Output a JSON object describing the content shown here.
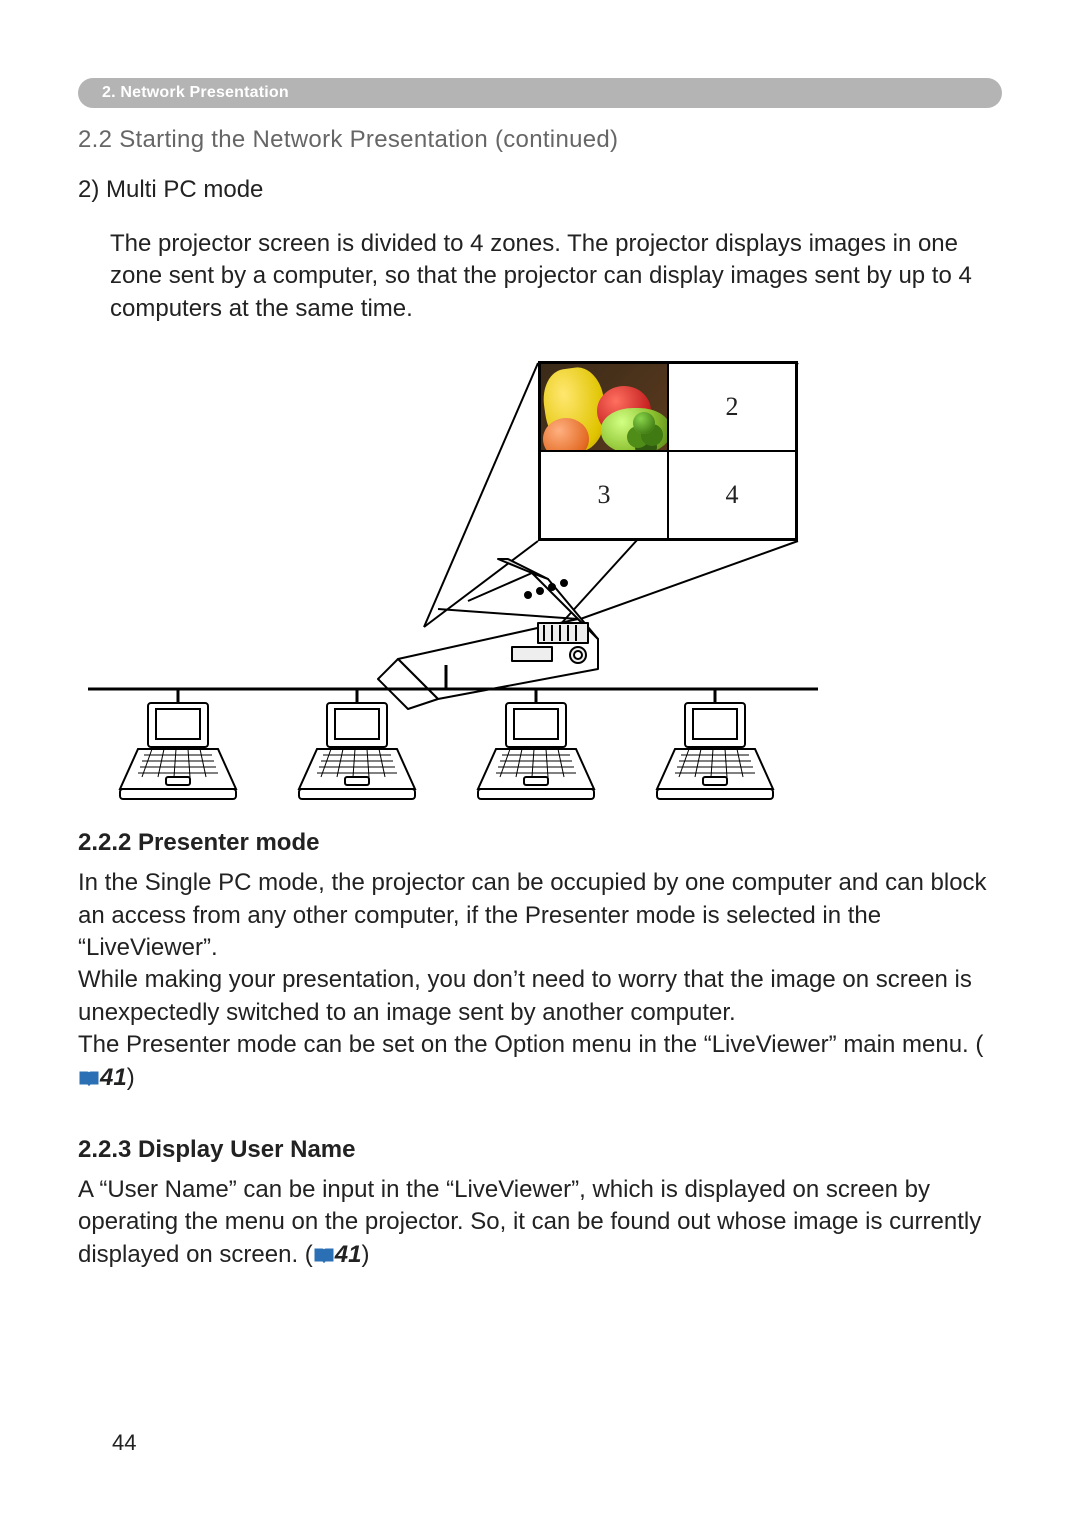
{
  "chapter_tab": "2. Network Presentation",
  "section_title": "2.2 Starting the Network Presentation (continued)",
  "multi_pc": {
    "heading": "2) Multi PC mode",
    "body": "The projector screen is divided to 4 zones. The projector displays images in one zone sent by a computer, so that the projector can display images sent by up to 4 computers at the same time."
  },
  "zones": {
    "z2": "2",
    "z3": "3",
    "z4": "4"
  },
  "presenter": {
    "heading": "2.2.2 Presenter mode",
    "p1": "In the Single PC mode, the projector can be occupied by one computer and can block an access from any other computer, if the Presenter mode is selected in the “LiveViewer”.",
    "p2": "While making your presentation, you don’t need to worry that the image on screen is unexpectedly switched to an image sent by another computer.",
    "p3a": "The Presenter mode can be set on the Option menu in the “LiveViewer” main menu. (",
    "ref": "41",
    "p3b": ")"
  },
  "username": {
    "heading": "2.2.3 Display User Name",
    "p1a": "A “User Name” can be input in the “LiveViewer”, which is displayed on screen by operating the menu on the projector. So, it can be found out whose image is currently displayed on screen. (",
    "ref": "41",
    "p1b": ")"
  },
  "page_number": "44"
}
